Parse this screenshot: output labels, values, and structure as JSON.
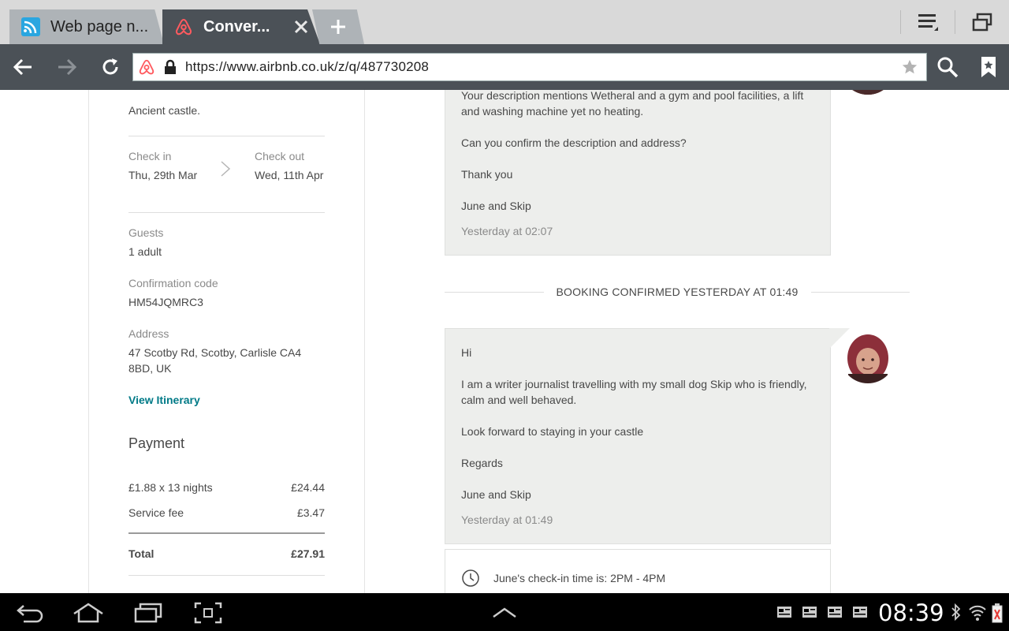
{
  "browser": {
    "tabs": [
      {
        "label": "Web page n...",
        "icon": "wifi-web-icon",
        "active": false
      },
      {
        "label": "Conver...",
        "icon": "airbnb-logo-icon",
        "active": true
      }
    ],
    "url": "https://www.airbnb.co.uk/z/q/487730208"
  },
  "sidebar": {
    "listing_title": "Ancient castle.",
    "check_in_label": "Check in",
    "check_in_value": "Thu, 29th Mar",
    "check_out_label": "Check out",
    "check_out_value": "Wed, 11th Apr",
    "guests_label": "Guests",
    "guests_value": "1 adult",
    "confirmation_label": "Confirmation code",
    "confirmation_value": "HM54JQMRC3",
    "address_label": "Address",
    "address_value": "47 Scotby Rd, Scotby, Carlisle CA4 8BD, UK",
    "itinerary_link": "View Itinerary",
    "payment_title": "Payment",
    "payment_rows": [
      {
        "label": "£1.88 x 13 nights",
        "amount": "£24.44"
      },
      {
        "label": "Service fee",
        "amount": "£3.47"
      }
    ],
    "total_label": "Total",
    "total_amount": "£27.91"
  },
  "messages": {
    "first": {
      "lines": [
        "Your description mentions Wetheral and a gym and pool facilities,  a lift and  washing machine  yet no heating.",
        "Can you confirm the description and  address?",
        "Thank you",
        "June and Skip"
      ],
      "time": "Yesterday at 02:07"
    },
    "booking_divider": "BOOKING CONFIRMED YESTERDAY AT 01:49",
    "second": {
      "lines": [
        "Hi",
        "I am a writer  journalist travelling with my small dog Skip  who is friendly, calm and well behaved.",
        "Look forward to staying in your castle",
        "Regards",
        "June and Skip"
      ],
      "time": "Yesterday at 01:49"
    },
    "checkin_info": "June's check-in time is: 2PM - 4PM"
  },
  "system": {
    "clock": "08:39"
  },
  "colors": {
    "airbnb": "#ff5a5f",
    "link_teal": "#007a87",
    "bubble_bg": "#edeeec",
    "toolbar_bg": "#4b5157"
  }
}
